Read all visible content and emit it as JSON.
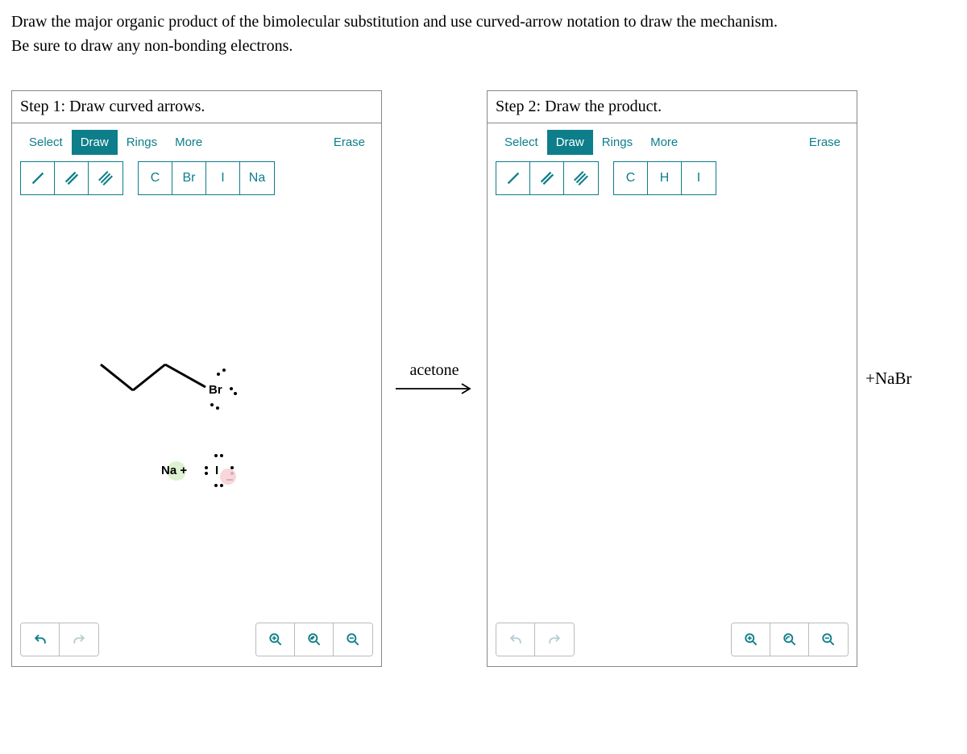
{
  "question": {
    "line1": "Draw the major organic product of the bimolecular substitution and use curved-arrow notation to draw the mechanism.",
    "line2": "Be sure to draw any non-bonding electrons."
  },
  "panels": {
    "left": {
      "title": "Step 1: Draw curved arrows.",
      "tabs": {
        "select": "Select",
        "draw": "Draw",
        "rings": "Rings",
        "more": "More"
      },
      "erase": "Erase",
      "atoms": {
        "a1": "C",
        "a2": "Br",
        "a3": "I",
        "a4": "Na"
      },
      "molecule": {
        "br": "Br",
        "na": "Na +",
        "i": "I"
      }
    },
    "right": {
      "title": "Step 2: Draw the product.",
      "tabs": {
        "select": "Select",
        "draw": "Draw",
        "rings": "Rings",
        "more": "More"
      },
      "erase": "Erase",
      "atoms": {
        "a1": "C",
        "a2": "H",
        "a3": "I"
      }
    }
  },
  "reaction": {
    "solvent": "acetone",
    "byproduct": "+NaBr"
  }
}
